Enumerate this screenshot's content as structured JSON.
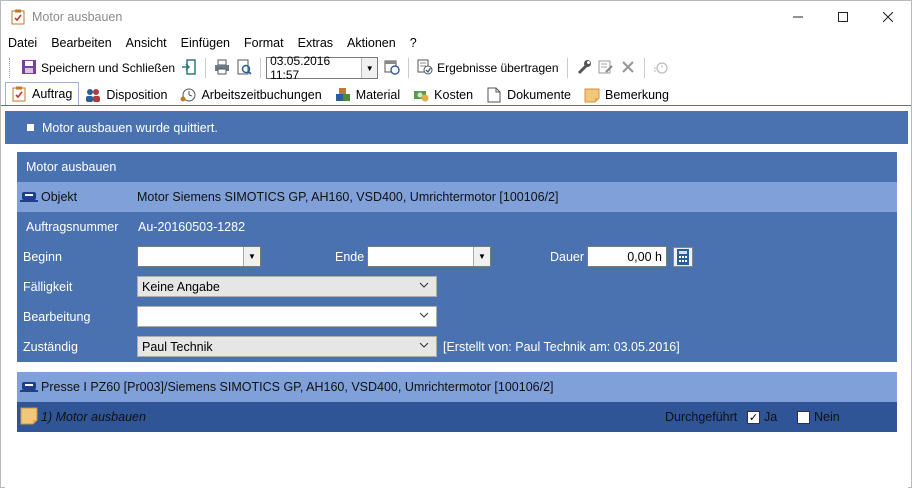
{
  "window": {
    "title": "Motor ausbauen"
  },
  "menu": [
    "Datei",
    "Bearbeiten",
    "Ansicht",
    "Einfügen",
    "Format",
    "Extras",
    "Aktionen",
    "?"
  ],
  "toolbar": {
    "save_close_label": "Speichern und Schließen",
    "date_value": "03.05.2016 11:57",
    "transfer_label": "Ergebnisse übertragen"
  },
  "tabs": [
    {
      "label": "Auftrag",
      "icon": "clipboard-check-icon",
      "active": true
    },
    {
      "label": "Disposition",
      "icon": "people-icon"
    },
    {
      "label": "Arbeitszeitbuchungen",
      "icon": "clock-person-icon"
    },
    {
      "label": "Material",
      "icon": "cubes-icon"
    },
    {
      "label": "Kosten",
      "icon": "money-icon"
    },
    {
      "label": "Dokumente",
      "icon": "document-icon"
    },
    {
      "label": "Bemerkung",
      "icon": "note-icon"
    }
  ],
  "status": {
    "text": "Motor ausbauen wurde quittiert."
  },
  "section": {
    "title": "Motor ausbauen",
    "objekt_label": "Objekt",
    "objekt_value": "Motor Siemens SIMOTICS GP, AH160, VSD400, Umrichtermotor [100106/2]"
  },
  "form": {
    "auftragsnummer_label": "Auftragsnummer",
    "auftragsnummer_value": "Au-20160503-1282",
    "beginn_label": "Beginn",
    "beginn_value": "",
    "ende_label": "Ende",
    "ende_value": "",
    "dauer_label": "Dauer",
    "dauer_value": "0,00 h",
    "faelligkeit_label": "Fälligkeit",
    "faelligkeit_value": "Keine Angabe",
    "bearbeitung_label": "Bearbeitung",
    "bearbeitung_value": "",
    "zustaendig_label": "Zuständig",
    "zustaendig_value": "Paul Technik",
    "created_note": "[Erstellt von: Paul Technik am: 03.05.2016]"
  },
  "object2": {
    "value": "Presse I PZ60 [Pr003]/Siemens SIMOTICS GP, AH160, VSD400, Umrichtermotor [100106/2]"
  },
  "task": {
    "title": "1) Motor ausbauen",
    "done_label": "Durchgeführt",
    "ja_label": "Ja",
    "ja_checked": true,
    "nein_label": "Nein",
    "nein_checked": false
  },
  "colors": {
    "panel_dark": "#4a72b0",
    "panel_light": "#7fa0d8",
    "task_row": "#2f5597"
  }
}
